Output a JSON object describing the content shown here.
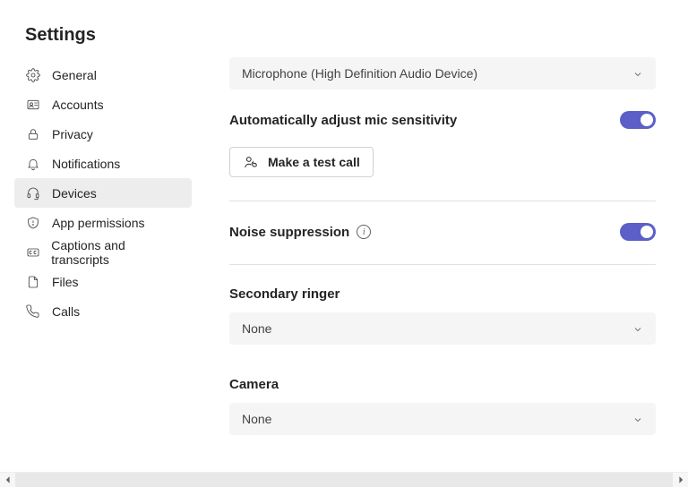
{
  "title": "Settings",
  "sidebar": {
    "items": [
      {
        "label": "General"
      },
      {
        "label": "Accounts"
      },
      {
        "label": "Privacy"
      },
      {
        "label": "Notifications"
      },
      {
        "label": "Devices"
      },
      {
        "label": "App permissions"
      },
      {
        "label": "Captions and transcripts"
      },
      {
        "label": "Files"
      },
      {
        "label": "Calls"
      }
    ]
  },
  "main": {
    "microphone_select": "Microphone (High Definition Audio Device)",
    "auto_adjust_label": "Automatically adjust mic sensitivity",
    "auto_adjust_on": true,
    "test_call_label": "Make a test call",
    "noise_suppression_label": "Noise suppression",
    "noise_suppression_on": true,
    "secondary_ringer_label": "Secondary ringer",
    "secondary_ringer_value": "None",
    "camera_label": "Camera",
    "camera_value": "None"
  },
  "colors": {
    "accent": "#5b5fc7"
  }
}
